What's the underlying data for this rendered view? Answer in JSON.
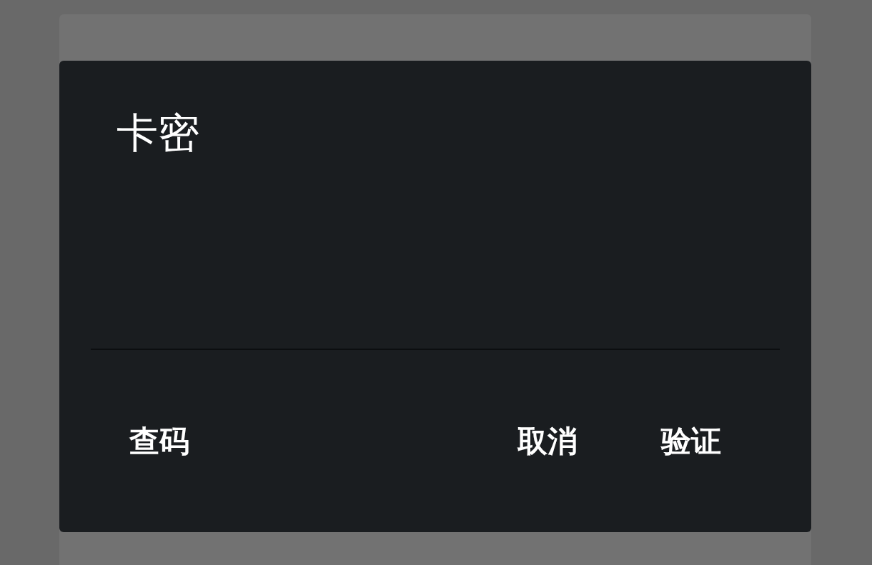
{
  "dialog": {
    "title": "卡密",
    "buttons": [
      {
        "label": "查码",
        "kind": "neutral"
      },
      {
        "label": "取消",
        "kind": "dismiss"
      },
      {
        "label": "验证",
        "kind": "confirm"
      }
    ]
  }
}
